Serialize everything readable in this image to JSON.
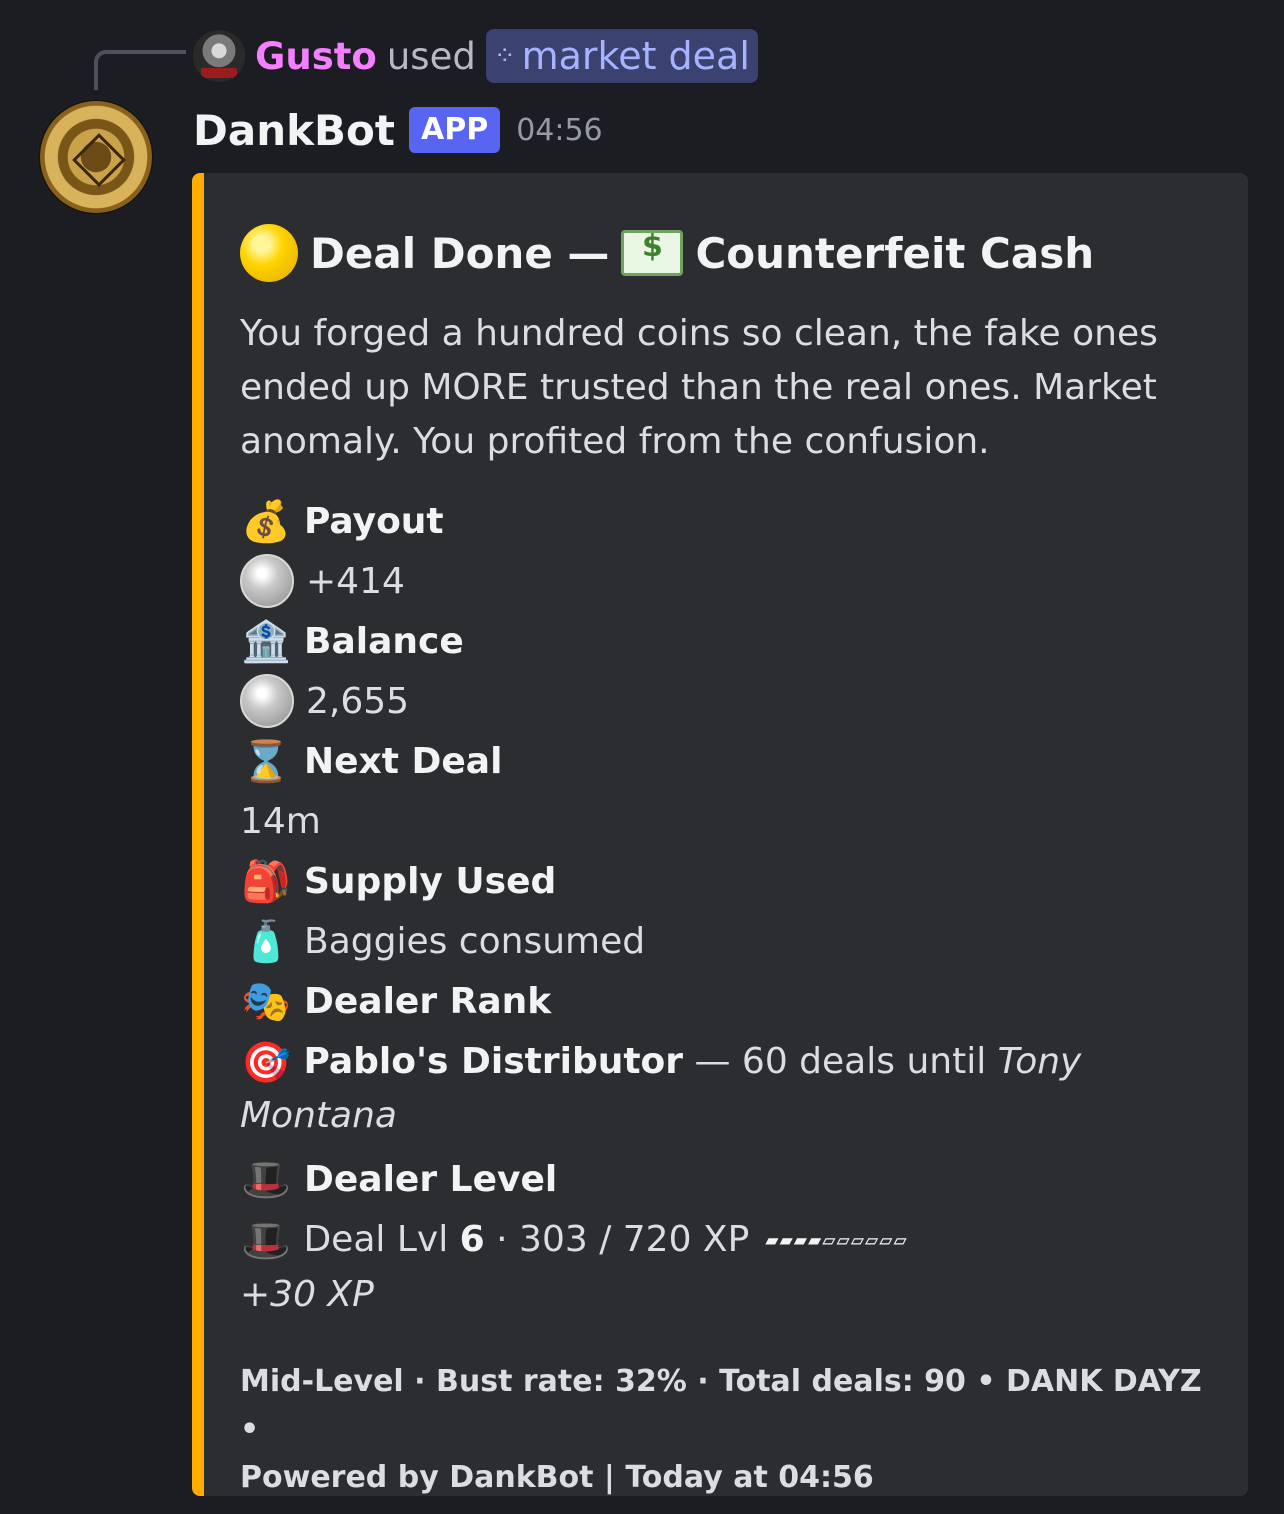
{
  "reply": {
    "user": "Gusto",
    "used": "used",
    "command": "market deal",
    "command_icon": "apps-icon"
  },
  "message": {
    "bot_name": "DankBot",
    "badge": "APP",
    "time": "04:56"
  },
  "embed": {
    "accent_color": "#ffab00",
    "title_prefix": "Deal Done —",
    "title_suffix": "Counterfeit Cash",
    "description": "You forged a hundred coins so clean, the fake ones ended up MORE trusted than the real ones. Market anomaly. You profited from the confusion.",
    "payout_name": "Payout",
    "payout_value": "+414",
    "balance_name": "Balance",
    "balance_value": "2,655",
    "next_deal_name": "Next Deal",
    "next_deal_value": "14m",
    "supply_name": "Supply Used",
    "supply_value": "Baggies consumed",
    "rank_name": "Dealer Rank",
    "rank_title": "Pablo's Distributor",
    "rank_sep": " — 60 deals until ",
    "rank_next": "Tony Montana",
    "level_name": "Dealer Level",
    "level_prefix": "Deal Lvl ",
    "level_num": "6",
    "level_xp": " · 303 / 720 XP",
    "xp_bar": "▰▰▰▰▱▱▱▱▱▱",
    "xp_gain": "+30 XP",
    "footer_1": "Mid-Level · Bust rate: 32% · Total deals: 90 • DANK DAYZ •",
    "footer_2": "Powered by DankBot | Today at 04:56"
  },
  "icons": {
    "payout": "money-bag-icon",
    "balance": "bank-icon",
    "next_deal": "hourglass-icon",
    "supply": "backpack-icon",
    "supply_item": "lotion-bottle-icon",
    "rank": "theater-masks-icon",
    "rank_item": "target-icon",
    "level": "top-hat-icon"
  }
}
